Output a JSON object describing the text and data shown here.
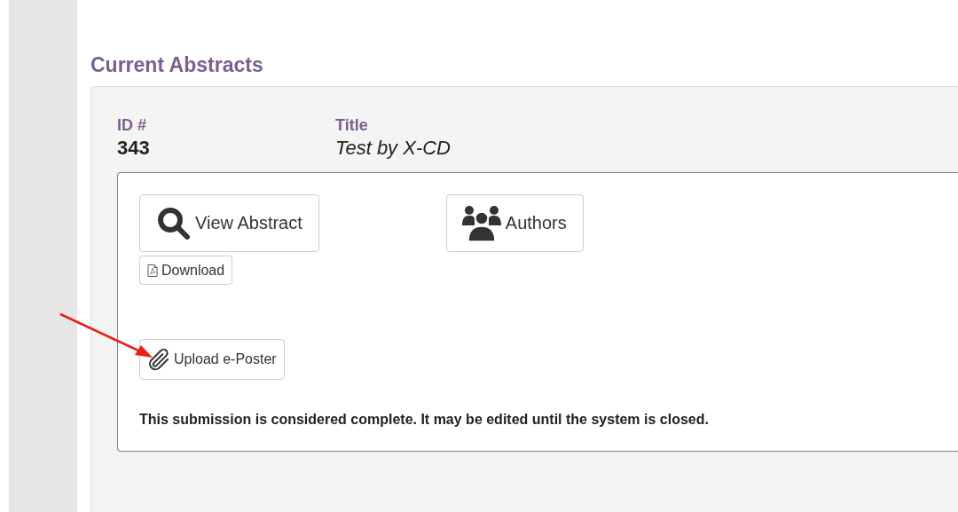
{
  "heading": "Current Abstracts",
  "abstract": {
    "id_label": "ID #",
    "id": "343",
    "title_label": "Title",
    "title": "Test by X-CD",
    "buttons": [
      {
        "kind": "search",
        "label": "View Abstract"
      },
      {
        "kind": "users",
        "label": "Authors"
      }
    ],
    "download": {
      "label": "Download"
    },
    "upload": {
      "label": "Upload e-Poster"
    },
    "status": "This submission is considered complete. It may be edited until the system is closed."
  }
}
